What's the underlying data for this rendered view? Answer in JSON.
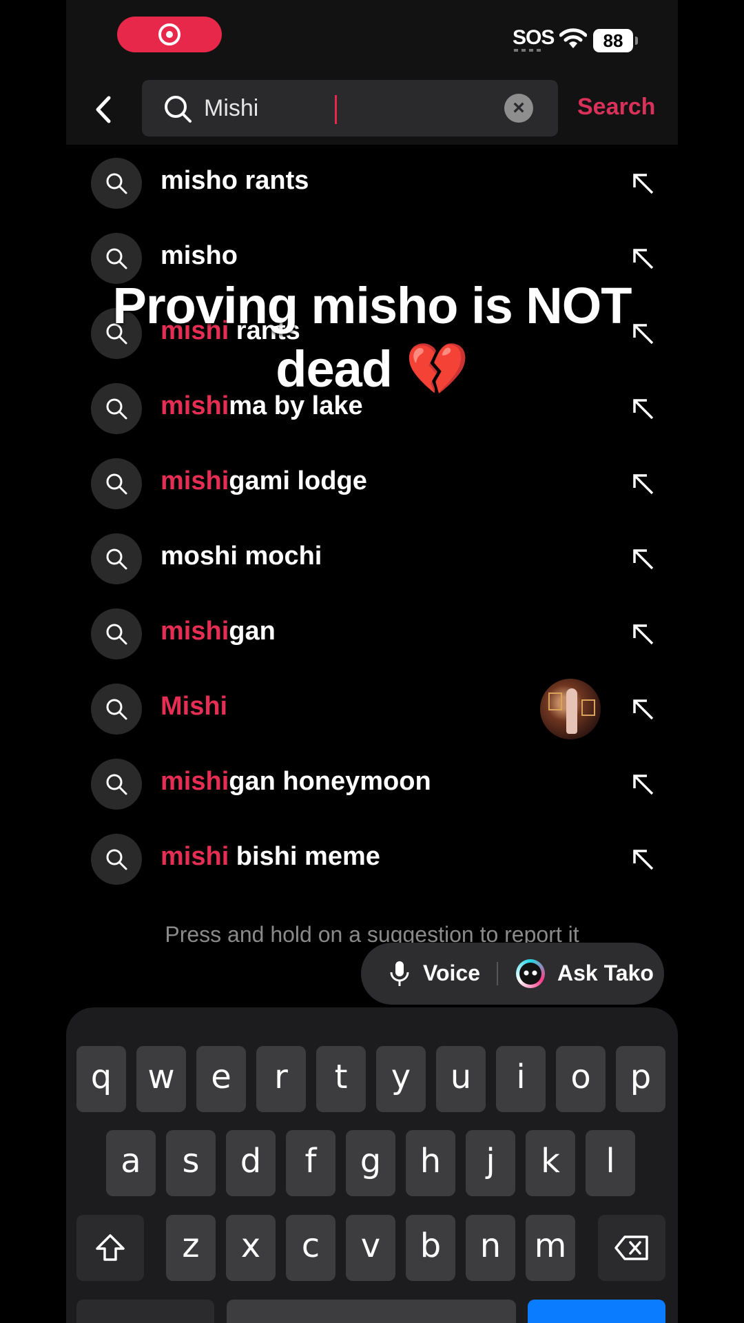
{
  "status_bar": {
    "sos": "SOS",
    "battery": "88"
  },
  "search": {
    "query": "Mishi",
    "search_button": "Search"
  },
  "suggestions": [
    {
      "highlight": "",
      "rest": "misho rants"
    },
    {
      "highlight": "",
      "rest": "misho"
    },
    {
      "highlight": "mishi",
      "rest": " rants"
    },
    {
      "highlight": "mishi",
      "rest": "ma by lake"
    },
    {
      "highlight": "mishi",
      "rest": "gami lodge"
    },
    {
      "highlight": "",
      "rest": "moshi mochi"
    },
    {
      "highlight": "mishi",
      "rest": "gan"
    },
    {
      "highlight": "Mishi",
      "rest": ""
    },
    {
      "highlight": "mishi",
      "rest": "gan honeymoon"
    },
    {
      "highlight": "mishi",
      "rest": " bishi meme"
    }
  ],
  "overlay": {
    "line1": "Proving misho is NOT",
    "line2": "dead 💔"
  },
  "hint": "Press and hold on a suggestion to report it",
  "assistant_bar": {
    "voice": "Voice",
    "ask": "Ask Tako"
  },
  "keyboard": {
    "row1": [
      "q",
      "w",
      "e",
      "r",
      "t",
      "y",
      "u",
      "i",
      "o",
      "p"
    ],
    "row2": [
      "a",
      "s",
      "d",
      "f",
      "g",
      "h",
      "j",
      "k",
      "l"
    ],
    "row3": [
      "z",
      "x",
      "c",
      "v",
      "b",
      "n",
      "m"
    ]
  },
  "colors": {
    "accent": "#e62e54",
    "record": "#e8284a",
    "keyboard_action": "#0a7cff"
  },
  "icons": {
    "back": "chevron-left-icon",
    "search": "magnifier-icon",
    "clear": "close-circle-icon",
    "fill": "arrow-up-left-icon",
    "mic": "microphone-icon",
    "tako": "tako-assistant-icon",
    "shift": "shift-arrow-icon",
    "backspace": "backspace-icon"
  }
}
